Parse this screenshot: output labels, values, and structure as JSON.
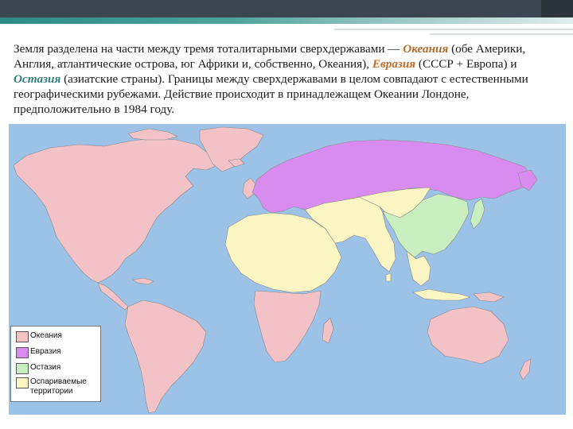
{
  "intro": {
    "part1": "Земля разделена на части между тремя тоталитарными сверхдержавами — ",
    "oceania": "Океания",
    "part2": " (обе Америки, Англия, атлантические острова, юг Африки и, собственно, Океания), ",
    "eurasia": "Евразия",
    "part3": " (СССР + Европа) и ",
    "eastasia": "Остазия",
    "part4": " (азиатские страны). Границы между сверхдержавами в целом совпадают с естественными географическими рубежами. Действие происходит в принадлежащем Океании Лондоне, предположительно в 1984 году."
  },
  "legend": {
    "items": [
      {
        "label": "Океания",
        "color": "#f2c2c6"
      },
      {
        "label": "Евразия",
        "color": "#d98cf0"
      },
      {
        "label": "Остазия",
        "color": "#c9efc1"
      },
      {
        "label": "Оспариваемые",
        "label2": "территории",
        "color": "#fbf5c4"
      }
    ]
  },
  "colors": {
    "ocean": "#9dc2e8",
    "oceania": "#f2c2c6",
    "eurasia": "#d98cf0",
    "eastasia": "#c9efc1",
    "disputed": "#fbf5c4"
  }
}
